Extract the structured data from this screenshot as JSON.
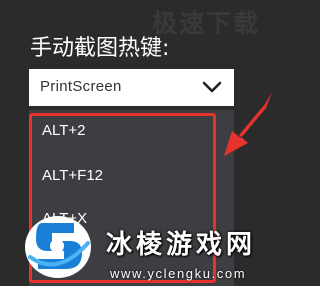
{
  "watermark_top": "极速下载",
  "hotkey_section": {
    "label": "手动截图热键:",
    "selected_value": "PrintScreen",
    "dropdown_icon": "chevron-down-icon",
    "options": [
      "ALT+2",
      "ALT+F12",
      "ALT+X"
    ]
  },
  "annotation": {
    "highlight_color": "#e8322e",
    "arrow_color": "#e8322e"
  },
  "watermark_site": {
    "name": "冰棱游戏网",
    "url": "www.yclengku.com"
  }
}
